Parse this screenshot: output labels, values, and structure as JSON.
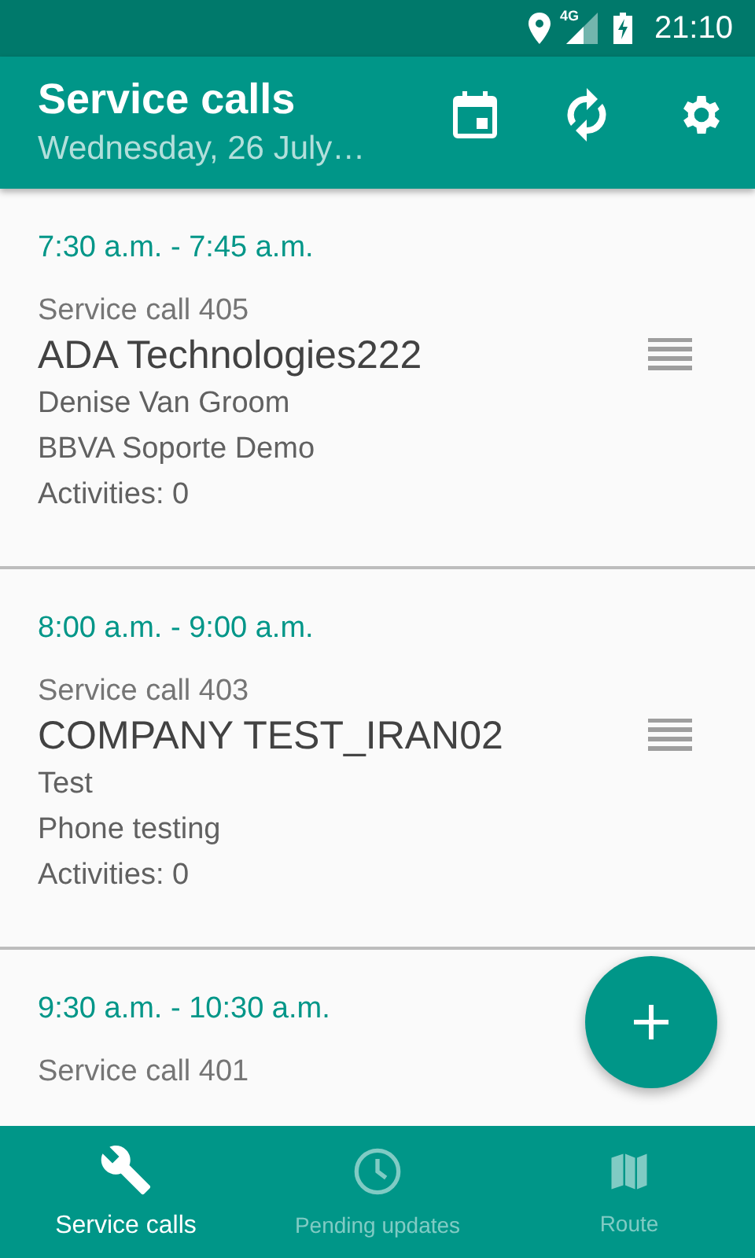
{
  "status_bar": {
    "network": "4G",
    "time": "21:10"
  },
  "app_bar": {
    "title": "Service calls",
    "subtitle": "Wednesday, 26 July…"
  },
  "calls": [
    {
      "time": "7:30 a.m. - 7:45 a.m.",
      "number": "Service call 405",
      "company": "ADA Technologies222",
      "contact": "Denise Van Groom",
      "project": "BBVA Soporte Demo",
      "activities": "Activities: 0"
    },
    {
      "time": "8:00 a.m. - 9:00 a.m.",
      "number": "Service call 403",
      "company": "COMPANY TEST_IRAN02",
      "contact": "Test",
      "project": "Phone testing",
      "activities": "Activities: 0"
    },
    {
      "time": "9:30 a.m. - 10:30 a.m.",
      "number": "Service call 401"
    }
  ],
  "bottom_nav": [
    {
      "kind": "wrench",
      "label": "Service calls",
      "selected": true
    },
    {
      "kind": "clock",
      "label": "Pending updates",
      "selected": false
    },
    {
      "kind": "map",
      "label": "Route",
      "selected": false
    }
  ]
}
